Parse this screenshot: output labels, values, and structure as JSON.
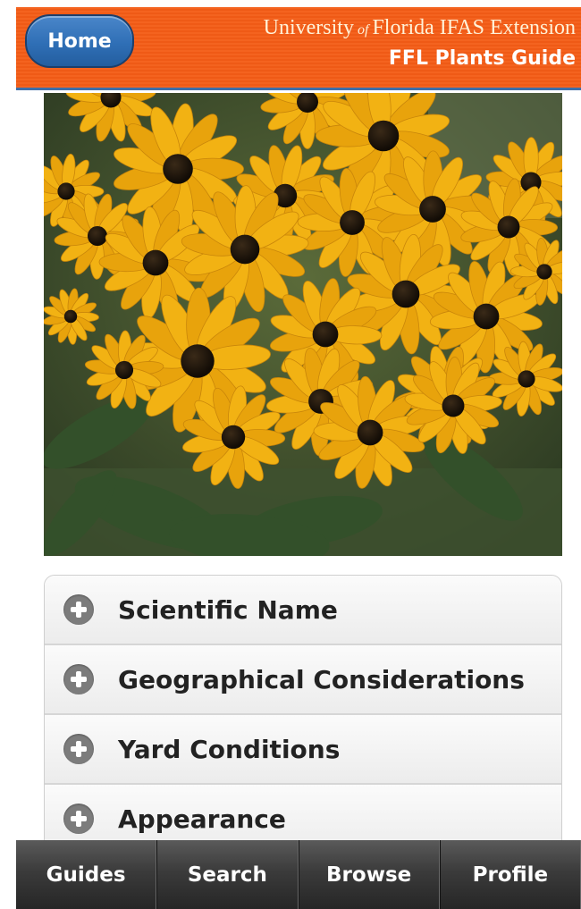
{
  "header": {
    "home_label": "Home",
    "university_pre": "University",
    "university_of": "of",
    "university_post": "Florida  IFAS Extension",
    "app_title": "FFL Plants Guide"
  },
  "photo": {
    "subject": "black-eyed susan flowers"
  },
  "accordion": {
    "items": [
      {
        "label": "Scientific Name",
        "icon": "plus-icon"
      },
      {
        "label": "Geographical Considerations",
        "icon": "plus-icon"
      },
      {
        "label": "Yard Conditions",
        "icon": "plus-icon"
      },
      {
        "label": "Appearance",
        "icon": "plus-icon"
      }
    ]
  },
  "tabbar": {
    "tabs": [
      {
        "label": "Guides"
      },
      {
        "label": "Search"
      },
      {
        "label": "Browse"
      },
      {
        "label": "Profile"
      }
    ]
  },
  "colors": {
    "header_orange": "#f4631f",
    "home_blue": "#2f6fb6",
    "petal_yellow": "#f2b213",
    "tabbar_dark": "#2b2b2b"
  }
}
